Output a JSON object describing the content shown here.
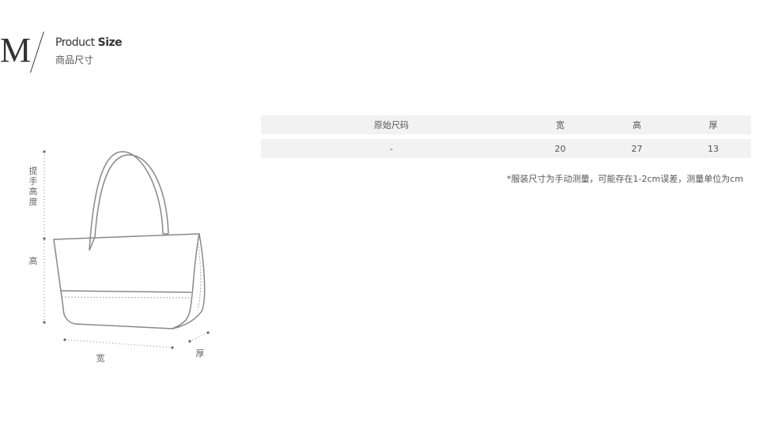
{
  "header": {
    "size_letter": "M",
    "title_light": "Product",
    "title_bold": "Size",
    "subtitle": "商品尺寸"
  },
  "diagram": {
    "handle_height_label": "提手高度",
    "height_label": "高",
    "width_label": "宽",
    "depth_label": "厚"
  },
  "table": {
    "headers": [
      "原始尺码",
      "宽",
      "高",
      "厚"
    ],
    "rows": [
      [
        "-",
        "20",
        "27",
        "13"
      ]
    ]
  },
  "note": "*服装尺寸为手动测量，可能存在1-2cm误差，测量单位为cm"
}
